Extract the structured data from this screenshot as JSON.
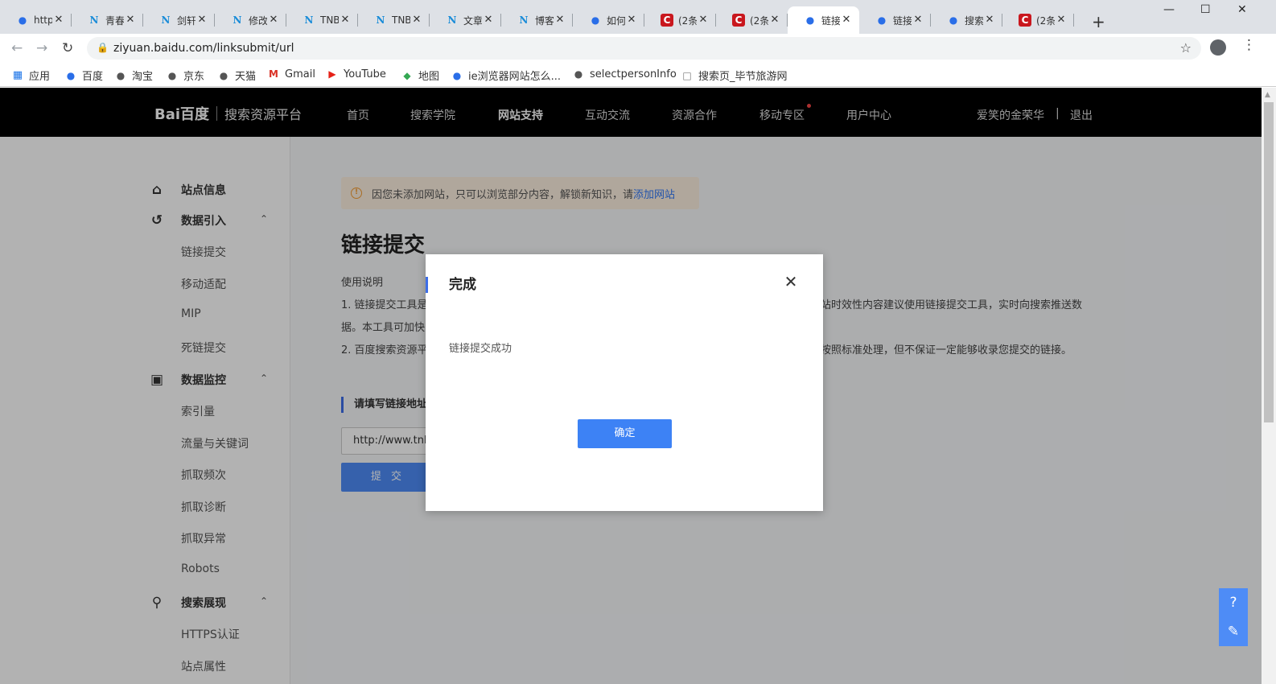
{
  "browser": {
    "tabs": [
      {
        "title": "http",
        "icon": "baidu-paw-icon"
      },
      {
        "title": "青春",
        "icon": "tn-icon"
      },
      {
        "title": "剑轩",
        "icon": "tn-icon"
      },
      {
        "title": "修改",
        "icon": "tn-icon"
      },
      {
        "title": "TNB",
        "icon": "tn-icon"
      },
      {
        "title": "TNB",
        "icon": "tn-icon"
      },
      {
        "title": "文章",
        "icon": "tn-icon"
      },
      {
        "title": "博客",
        "icon": "tn-icon"
      },
      {
        "title": "如何",
        "icon": "baidu-paw-icon"
      },
      {
        "title": "(2条",
        "icon": "csdn-icon"
      },
      {
        "title": "(2条",
        "icon": "csdn-icon"
      },
      {
        "title": "链接",
        "icon": "baidu-paw-icon",
        "active": true
      },
      {
        "title": "链接",
        "icon": "baidu-paw-icon"
      },
      {
        "title": "搜索",
        "icon": "baidu-paw-icon"
      },
      {
        "title": "(2条",
        "icon": "csdn-icon"
      }
    ],
    "new_tab": "+",
    "url": "ziyuan.baidu.com/linksubmit/url",
    "bookmarks": [
      {
        "label": "应用",
        "icon": "apps-grid-icon"
      },
      {
        "label": "百度",
        "icon": "baidu-paw-icon"
      },
      {
        "label": "淘宝",
        "icon": "globe-icon"
      },
      {
        "label": "京东",
        "icon": "globe-icon"
      },
      {
        "label": "天猫",
        "icon": "globe-icon"
      },
      {
        "label": "Gmail",
        "icon": "gmail-icon"
      },
      {
        "label": "YouTube",
        "icon": "youtube-icon"
      },
      {
        "label": "地图",
        "icon": "maps-icon"
      },
      {
        "label": "ie浏览器网站怎么...",
        "icon": "baidu-paw-icon"
      },
      {
        "label": "selectpersonInfo",
        "icon": "globe-icon"
      },
      {
        "label": "搜索页_毕节旅游网",
        "icon": "page-icon"
      }
    ]
  },
  "site": {
    "logo_text": "Bai百度",
    "platform_name": "搜索资源平台",
    "nav": [
      "首页",
      "搜索学院",
      "网站支持",
      "互动交流",
      "资源合作",
      "移动专区",
      "用户中心"
    ],
    "active_nav": "网站支持",
    "username": "爱笑的金荣华",
    "user_separator": "|",
    "logout": "退出"
  },
  "sidebar": {
    "groups": [
      {
        "label": "站点信息",
        "icon": "home-icon",
        "items": []
      },
      {
        "label": "数据引入",
        "icon": "data-import-icon",
        "items": [
          "链接提交",
          "移动适配",
          "MIP",
          "死链提交"
        ]
      },
      {
        "label": "数据监控",
        "icon": "chart-monitor-icon",
        "items": [
          "索引量",
          "流量与关键词",
          "抓取频次",
          "抓取诊断",
          "抓取异常",
          "Robots"
        ]
      },
      {
        "label": "搜索展现",
        "icon": "search-display-icon",
        "items": [
          "HTTPS认证",
          "站点属性"
        ]
      }
    ]
  },
  "main": {
    "alert_text": "因您未添加网站，只可以浏览部分内容，解锁新知识，请",
    "alert_link": "添加网站",
    "title": "链接提交",
    "usage_heading": "使用说明",
    "usage_lines": [
      "1. 链接提交工具是",
      "站时效性内容建议使用链接提交工具，实时向搜索推送数",
      "据。本工具可加快",
      "2. 百度搜索资源平",
      "按照标准处理，但不保证一定能够收录您提交的链接。"
    ],
    "section_heading": "请填写链接地址",
    "url_value": "http://www.tnbl",
    "submit_label": "提 交"
  },
  "modal": {
    "title": "完成",
    "message": "链接提交成功",
    "ok_label": "确定"
  },
  "colors": {
    "accent": "#3d82f5",
    "nav_bg": "#000000",
    "alert_bg": "#fdf0e0"
  }
}
